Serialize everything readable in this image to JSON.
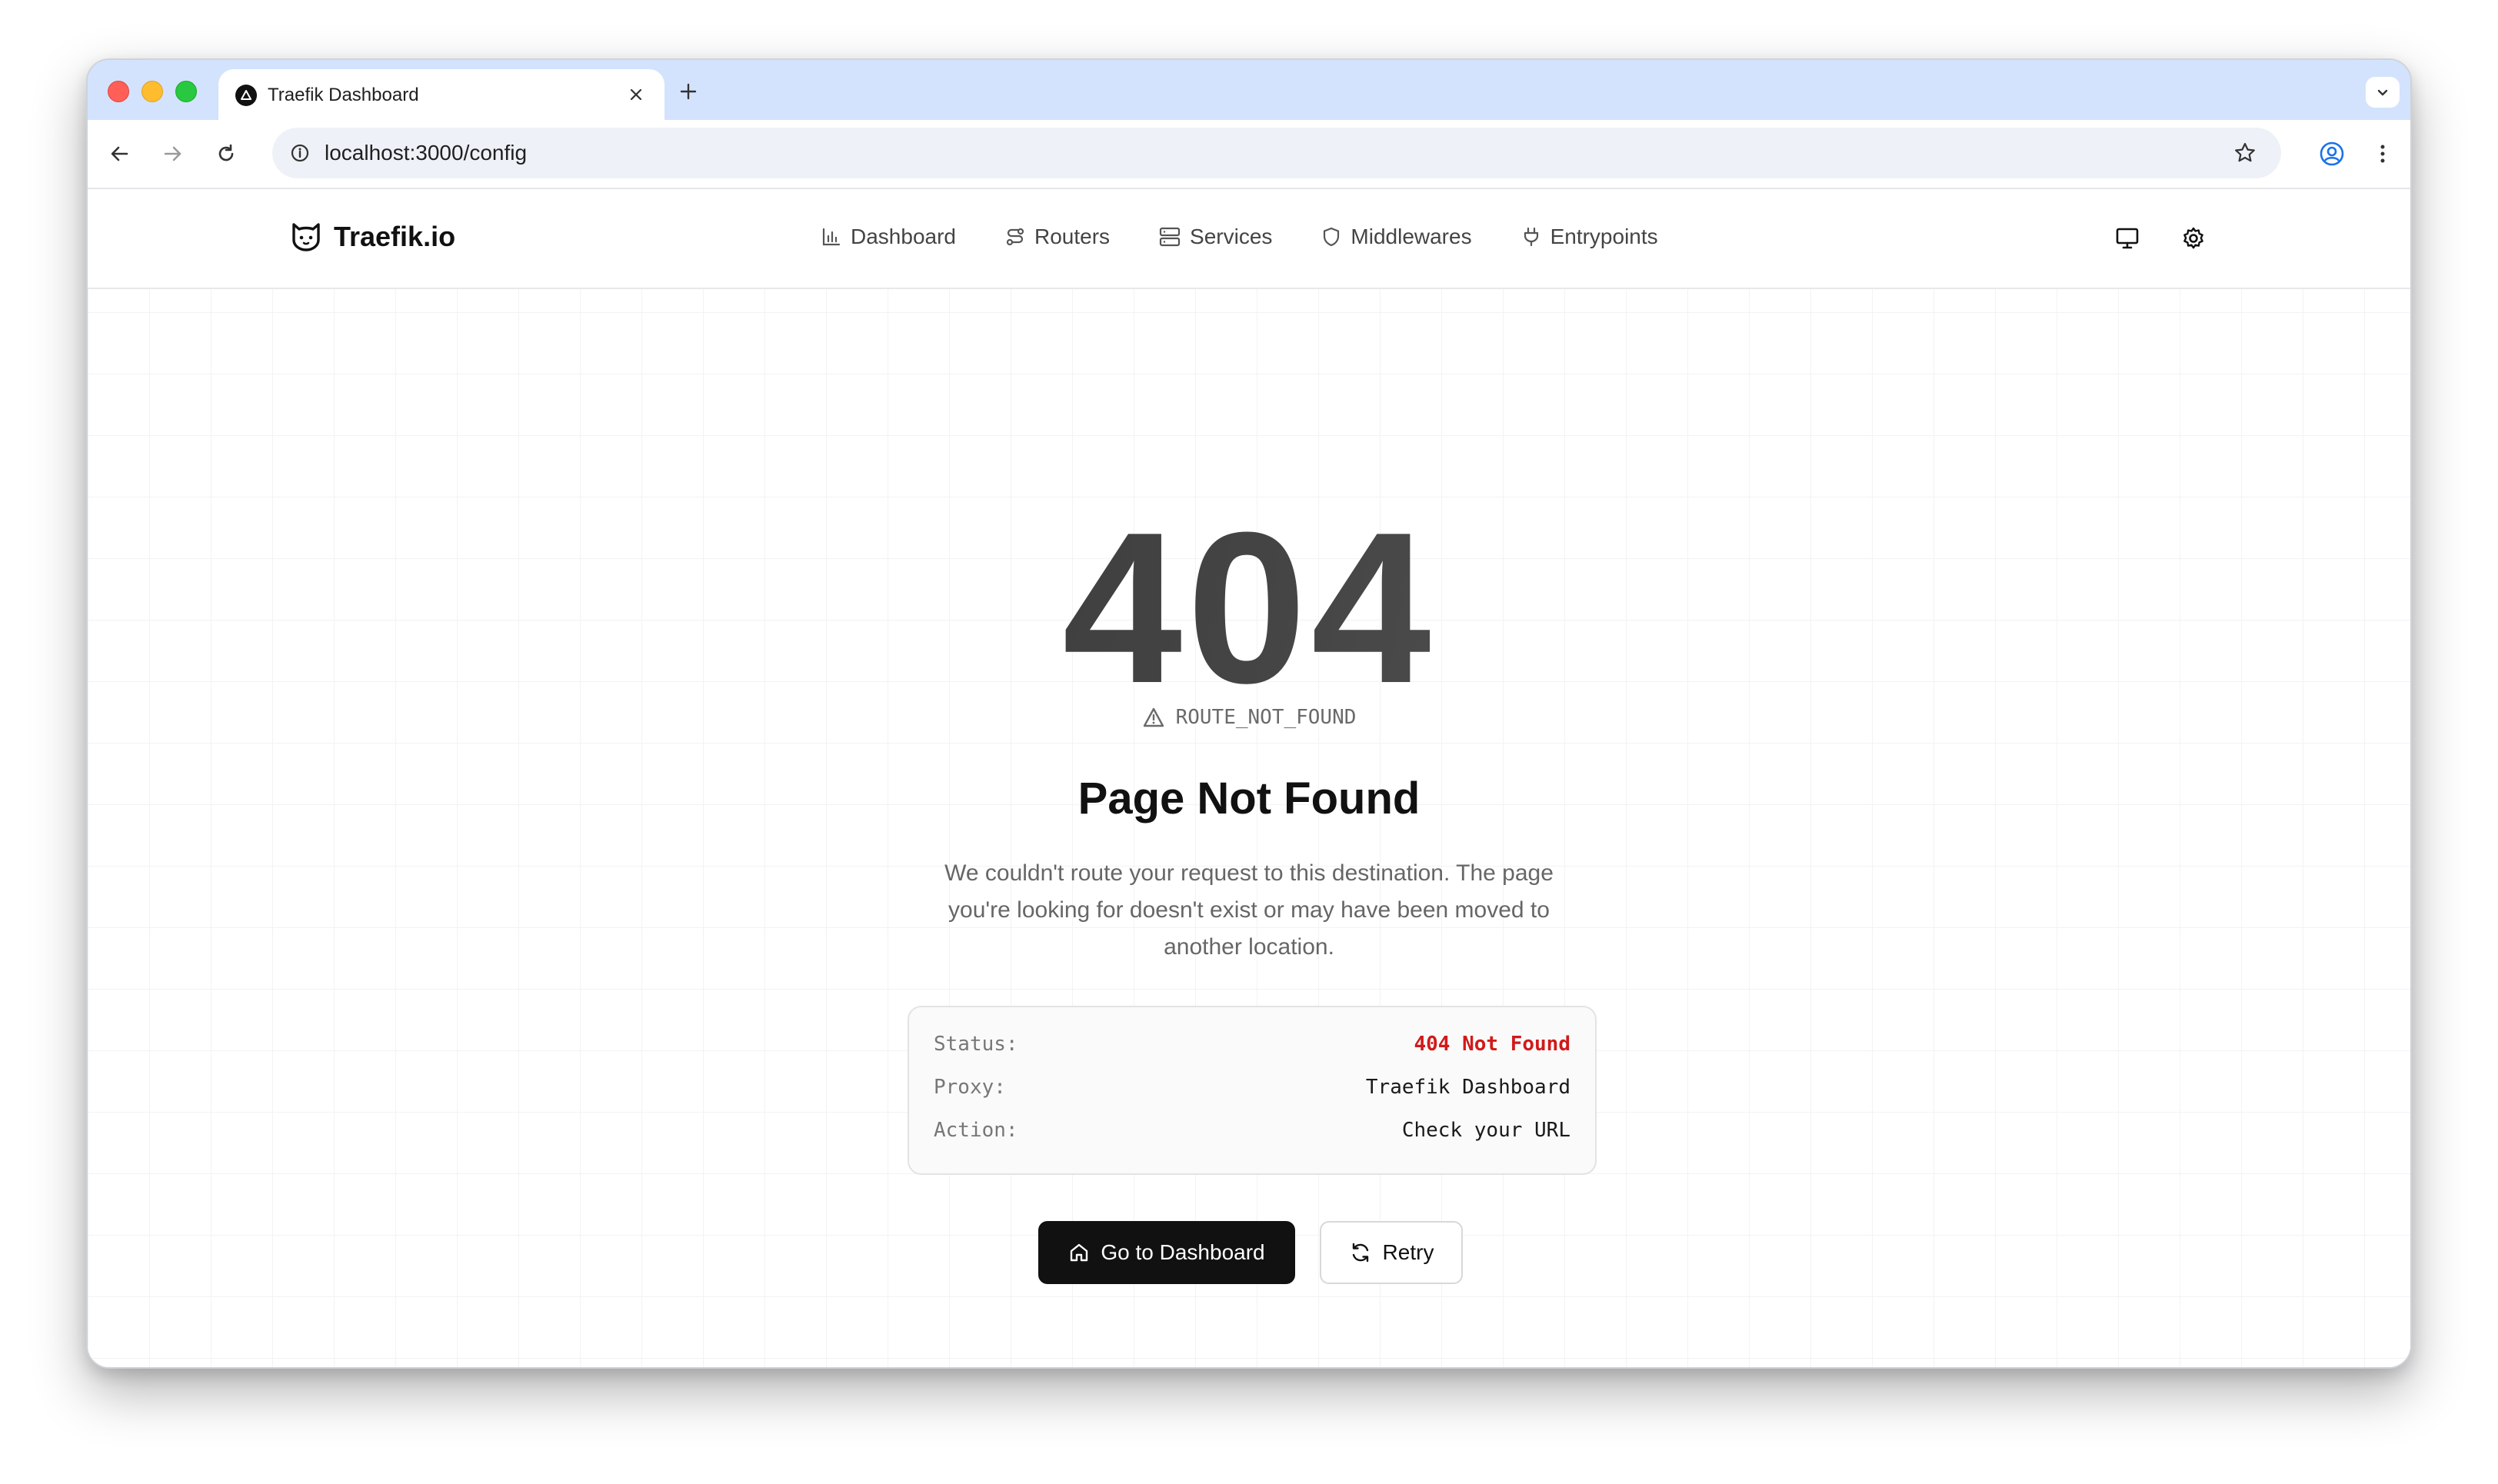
{
  "browser": {
    "tab_title": "Traefik Dashboard",
    "url": "localhost:3000/config"
  },
  "app": {
    "brand": "Traefik.io",
    "nav": [
      {
        "label": "Dashboard",
        "icon": "bar-chart-icon"
      },
      {
        "label": "Routers",
        "icon": "route-icon"
      },
      {
        "label": "Services",
        "icon": "server-icon"
      },
      {
        "label": "Middlewares",
        "icon": "shield-icon"
      },
      {
        "label": "Entrypoints",
        "icon": "plug-icon"
      }
    ]
  },
  "error": {
    "code": "404",
    "label": "ROUTE_NOT_FOUND",
    "title": "Page Not Found",
    "description": "We couldn't route your request to this destination. The page you're looking for doesn't exist or may have been moved to another location.",
    "details": [
      {
        "key": "Status:",
        "value": "404 Not Found"
      },
      {
        "key": "Proxy:",
        "value": "Traefik Dashboard"
      },
      {
        "key": "Action:",
        "value": "Check your URL"
      }
    ]
  },
  "actions": {
    "primary": "Go to Dashboard",
    "secondary": "Retry"
  },
  "colors": {
    "error": "#d11a1a",
    "primary_button": "#111111",
    "tab_strip": "#d3e3fd"
  }
}
